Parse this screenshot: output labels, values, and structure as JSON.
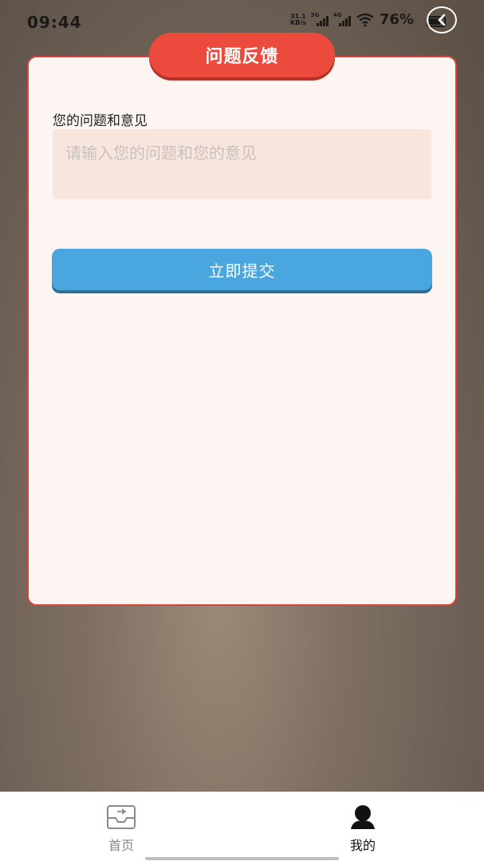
{
  "status_bar": {
    "time": "09:44",
    "net_speed_value": "31.1",
    "net_speed_unit": "KB/s",
    "signal_1_label": "5G",
    "signal_2_label": "4G",
    "battery_percent": "76%"
  },
  "page": {
    "title": "问题反馈"
  },
  "form": {
    "field_label": "您的问题和意见",
    "input_value": "",
    "input_placeholder": "请输入您的问题和您的意见",
    "submit_label": "立即提交"
  },
  "bottom_nav": {
    "items": [
      {
        "label": "首页",
        "icon": "home-inbox-icon",
        "active": false
      },
      {
        "label": "我的",
        "icon": "user-profile-icon",
        "active": true
      }
    ]
  },
  "colors": {
    "title_tab": "#ec4a3c",
    "card_border": "#d9443a",
    "card_bg": "#fdf5f1",
    "input_bg": "#f8e6de",
    "submit_button": "#4aa6de",
    "nav_active": "#111111",
    "nav_inactive": "#8a8a8a"
  }
}
